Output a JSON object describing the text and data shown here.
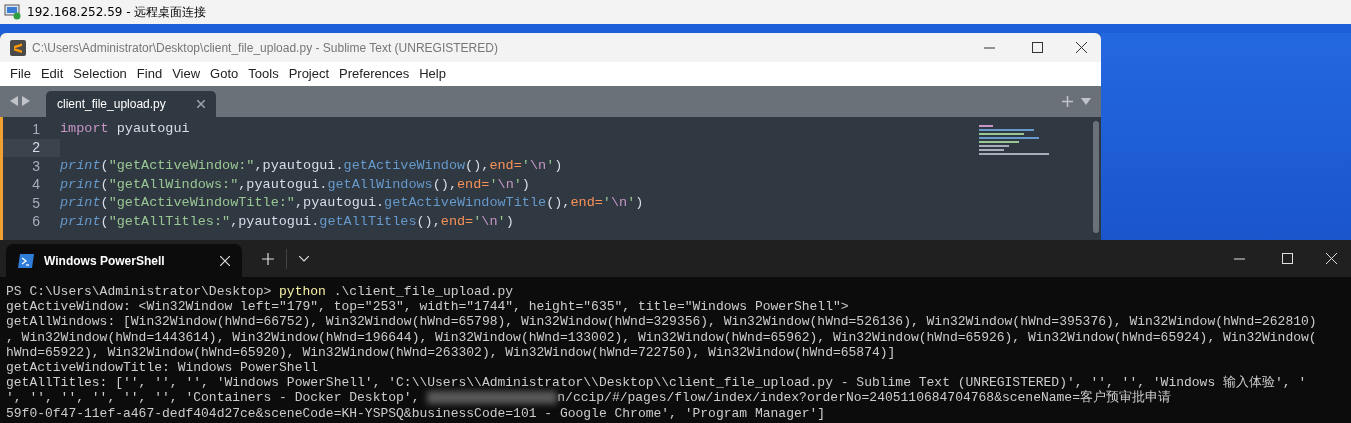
{
  "remote_desktop": {
    "title": "192.168.252.59 - 远程桌面连接"
  },
  "editor": {
    "title": "C:\\Users\\Administrator\\Desktop\\client_file_upload.py - Sublime Text (UNREGISTERED)",
    "menu": [
      "File",
      "Edit",
      "Selection",
      "Find",
      "View",
      "Goto",
      "Tools",
      "Project",
      "Preferences",
      "Help"
    ],
    "tabs": [
      {
        "label": "client_file_upload.py",
        "selected": true
      }
    ],
    "lines": [
      {
        "number": "1",
        "current": false,
        "tokens": [
          {
            "kind": "keyword",
            "text": "import"
          },
          {
            "kind": "plain",
            "text": " pyautogui"
          }
        ]
      },
      {
        "number": "2",
        "current": true
      },
      {
        "number": "3",
        "current": false,
        "tokens": [
          {
            "kind": "builtin",
            "text": "print"
          },
          {
            "kind": "plain",
            "text": "("
          },
          {
            "kind": "string",
            "text": "\"getActiveWindow:\""
          },
          {
            "kind": "plain",
            "text": ",pyautogui."
          },
          {
            "kind": "method",
            "text": "getActiveWindow"
          },
          {
            "kind": "plain",
            "text": "(),"
          },
          {
            "kind": "param",
            "text": "end="
          },
          {
            "kind": "string",
            "text": "'"
          },
          {
            "kind": "escape",
            "text": "\\n"
          },
          {
            "kind": "string",
            "text": "'"
          },
          {
            "kind": "plain",
            "text": ")"
          }
        ]
      },
      {
        "number": "4",
        "current": false,
        "tokens": [
          {
            "kind": "builtin",
            "text": "print"
          },
          {
            "kind": "plain",
            "text": "("
          },
          {
            "kind": "string",
            "text": "\"getAllWindows:\""
          },
          {
            "kind": "plain",
            "text": ",pyautogui."
          },
          {
            "kind": "method",
            "text": "getAllWindows"
          },
          {
            "kind": "plain",
            "text": "(),"
          },
          {
            "kind": "param",
            "text": "end="
          },
          {
            "kind": "string",
            "text": "'"
          },
          {
            "kind": "escape",
            "text": "\\n"
          },
          {
            "kind": "string",
            "text": "'"
          },
          {
            "kind": "plain",
            "text": ")"
          }
        ]
      },
      {
        "number": "5",
        "current": false,
        "tokens": [
          {
            "kind": "builtin",
            "text": "print"
          },
          {
            "kind": "plain",
            "text": "("
          },
          {
            "kind": "string",
            "text": "\"getActiveWindowTitle:\""
          },
          {
            "kind": "plain",
            "text": ",pyautogui."
          },
          {
            "kind": "method",
            "text": "getActiveWindowTitle"
          },
          {
            "kind": "plain",
            "text": "(),"
          },
          {
            "kind": "param",
            "text": "end="
          },
          {
            "kind": "string",
            "text": "'"
          },
          {
            "kind": "escape",
            "text": "\\n"
          },
          {
            "kind": "string",
            "text": "'"
          },
          {
            "kind": "plain",
            "text": ")"
          }
        ]
      },
      {
        "number": "6",
        "current": false,
        "tokens": [
          {
            "kind": "builtin",
            "text": "print"
          },
          {
            "kind": "plain",
            "text": "("
          },
          {
            "kind": "string",
            "text": "\"getAllTitles:\""
          },
          {
            "kind": "plain",
            "text": ",pyautogui."
          },
          {
            "kind": "method",
            "text": "getAllTitles"
          },
          {
            "kind": "plain",
            "text": "(),"
          },
          {
            "kind": "param",
            "text": "end="
          },
          {
            "kind": "string",
            "text": "'"
          },
          {
            "kind": "escape",
            "text": "\\n"
          },
          {
            "kind": "string",
            "text": "'"
          },
          {
            "kind": "plain",
            "text": ")"
          }
        ]
      }
    ]
  },
  "terminal": {
    "tabs": [
      {
        "label": "Windows PowerShell",
        "selected": true
      }
    ],
    "lines": [
      {
        "parts": [
          {
            "kind": "text",
            "text": "PS C:\\Users\\Administrator\\Desktop> "
          },
          {
            "kind": "command",
            "text": "python"
          },
          {
            "kind": "text",
            "text": " .\\client_file_upload.py"
          }
        ]
      },
      {
        "parts": [
          {
            "kind": "text",
            "text": "getActiveWindow: <Win32Window left=\"179\", top=\"253\", width=\"1744\", height=\"635\", title=\"Windows PowerShell\">"
          }
        ]
      },
      {
        "parts": [
          {
            "kind": "text",
            "text": "getAllWindows: [Win32Window(hWnd=66752), Win32Window(hWnd=65798), Win32Window(hWnd=329356), Win32Window(hWnd=526136), Win32Window(hWnd=395376), Win32Window(hWnd=262810)"
          }
        ]
      },
      {
        "parts": [
          {
            "kind": "text",
            "text": ", Win32Window(hWnd=1443614), Win32Window(hWnd=196644), Win32Window(hWnd=133002), Win32Window(hWnd=65962), Win32Window(hWnd=65926), Win32Window(hWnd=65924), Win32Window("
          }
        ]
      },
      {
        "parts": [
          {
            "kind": "text",
            "text": "hWnd=65922), Win32Window(hWnd=65920), Win32Window(hWnd=263302), Win32Window(hWnd=722750), Win32Window(hWnd=65874)]"
          }
        ]
      },
      {
        "parts": [
          {
            "kind": "text",
            "text": "getActiveWindowTitle: Windows PowerShell"
          }
        ]
      },
      {
        "parts": [
          {
            "kind": "text",
            "text": "getAllTitles: ['', '', '', 'Windows PowerShell', 'C:\\\\Users\\\\Administrator\\\\Desktop\\\\client_file_upload.py - Sublime Text (UNREGISTERED)', '', '', 'Windows 输入体验', '"
          }
        ]
      },
      {
        "parts": [
          {
            "kind": "text",
            "text": "', '', '', '', '', '', 'Containers - Docker Desktop', "
          },
          {
            "kind": "redacted"
          },
          {
            "kind": "text",
            "text": "n/ccip/#/pages/flow/index/index?orderNo=2405110684704768&sceneName=客户预审批申请"
          }
        ]
      },
      {
        "parts": [
          {
            "kind": "text",
            "text": "59f0-0f47-11ef-a467-dedf404d27ce&sceneCode=KH-YSPSQ&businessCode=101 - Google Chrome', 'Program Manager']"
          }
        ]
      }
    ]
  }
}
